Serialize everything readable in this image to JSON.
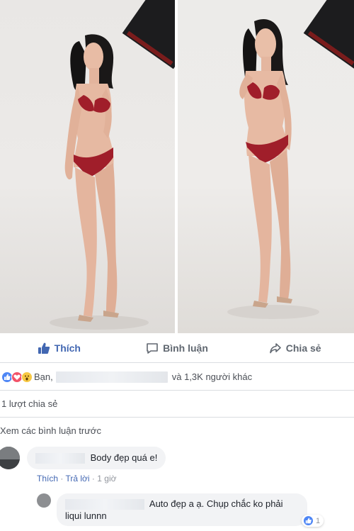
{
  "actions": {
    "like_label": "Thích",
    "comment_label": "Bình luận",
    "share_label": "Chia sẻ"
  },
  "reactions": {
    "icons": [
      "like-reaction",
      "love-reaction",
      "wow-reaction"
    ],
    "prefix": "Bạn,",
    "suffix": "và 1,3K người khác"
  },
  "shares_text": "1 lượt chia sẻ",
  "view_previous": "Xem các bình luận trước",
  "comments": [
    {
      "text": "Body đẹp quá e!",
      "like_label": "Thích",
      "reply_label": "Trả lời",
      "time": "1 giờ"
    }
  ],
  "reply": {
    "text": "Auto đẹp a ạ. Chụp chắc ko phải liqui lunnn",
    "line1": "Auto đẹp a ạ. Chụp chắc ko phải",
    "line2": "liqui lunnn",
    "reaction_count": "1"
  },
  "colors": {
    "facebook_blue": "#4267b2",
    "bikini_red": "#a01e2a",
    "gray_text": "#606770"
  }
}
